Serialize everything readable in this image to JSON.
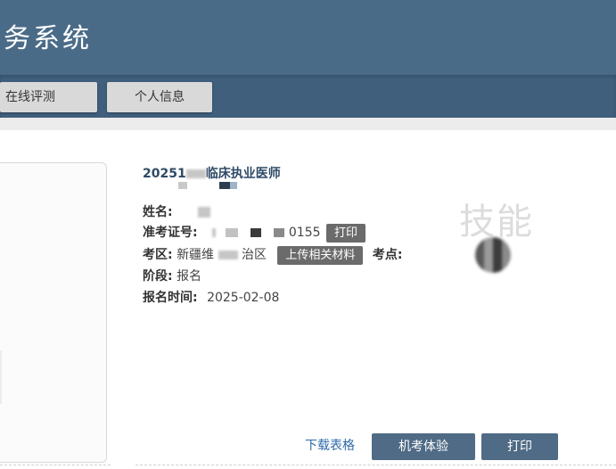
{
  "header": {
    "title": "务系统"
  },
  "nav": {
    "tab1": "在线评测",
    "tab2": "个人信息"
  },
  "exam": {
    "title": "20251",
    "title_rest": "临床执业医师",
    "name_label": "姓名:",
    "ticket_label": "准考证号:",
    "ticket_suffix": "0155",
    "print_label": "打印",
    "area_label": "考区:",
    "area_value_start": "新疆维",
    "area_value_end": "治区",
    "upload_label": "上传相关材料",
    "site_label": "考点:",
    "stage_label": "阶段:",
    "stage_value": "报名",
    "time_label": "报名时间:",
    "time_value": "2025-02-08"
  },
  "watermark": "技能",
  "actions": {
    "download_link": "下载表格",
    "mock_exam": "机考体验",
    "print": "打印"
  }
}
